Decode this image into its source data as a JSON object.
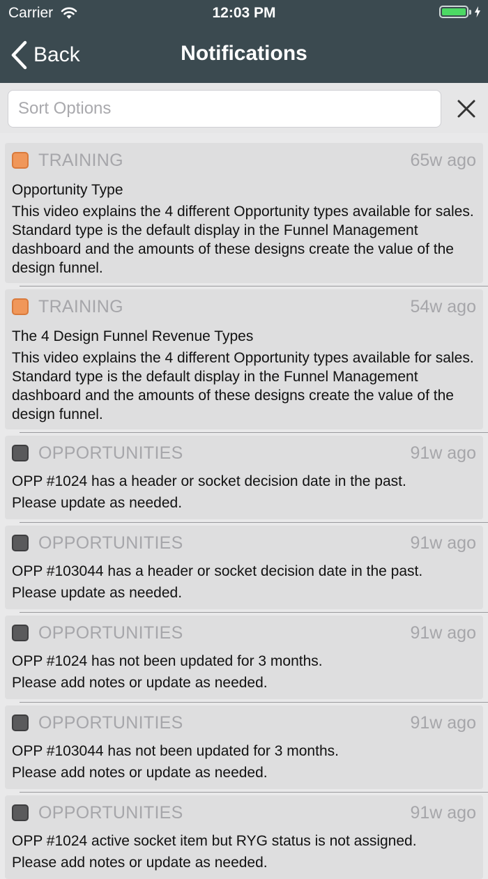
{
  "status_bar": {
    "carrier": "Carrier",
    "time": "12:03 PM",
    "battery_level": 1.0
  },
  "nav": {
    "back_label": "Back",
    "title": "Notifications"
  },
  "search": {
    "placeholder": "Sort Options"
  },
  "notifications": [
    {
      "category": "TRAINING",
      "category_color": "#f0975a",
      "age": "65w ago",
      "title": "Opportunity Type",
      "body": "This video explains the 4 different Opportunity types available for sales. Standard type is the default display in the Funnel Management dashboard and the amounts of these designs create the value of the design funnel."
    },
    {
      "category": "TRAINING",
      "category_color": "#f0975a",
      "age": "54w ago",
      "title": "The 4 Design Funnel Revenue Types",
      "body": "This video explains the 4 different Opportunity types available for sales. Standard type is the default display in the Funnel Management dashboard and the amounts of these designs create the value of the design funnel."
    },
    {
      "category": "OPPORTUNITIES",
      "category_color": "#5a5a5c",
      "age": "91w ago",
      "line1": "OPP #1024 has a header or socket decision date in the past.",
      "line2": "Please update as needed."
    },
    {
      "category": "OPPORTUNITIES",
      "category_color": "#5a5a5c",
      "age": "91w ago",
      "line1": "OPP #103044 has a header or socket decision date in the past.",
      "line2": "Please update as needed."
    },
    {
      "category": "OPPORTUNITIES",
      "category_color": "#5a5a5c",
      "age": "91w ago",
      "line1": "OPP #1024 has not been updated for 3 months.",
      "line2": "Please add notes or update as needed."
    },
    {
      "category": "OPPORTUNITIES",
      "category_color": "#5a5a5c",
      "age": "91w ago",
      "line1": "OPP #103044 has not been updated for 3 months.",
      "line2": "Please add notes or update as needed."
    },
    {
      "category": "OPPORTUNITIES",
      "category_color": "#5a5a5c",
      "age": "91w ago",
      "line1": "OPP #1024 active socket item but RYG status is not assigned.",
      "line2": "Please add notes or update as needed."
    }
  ]
}
